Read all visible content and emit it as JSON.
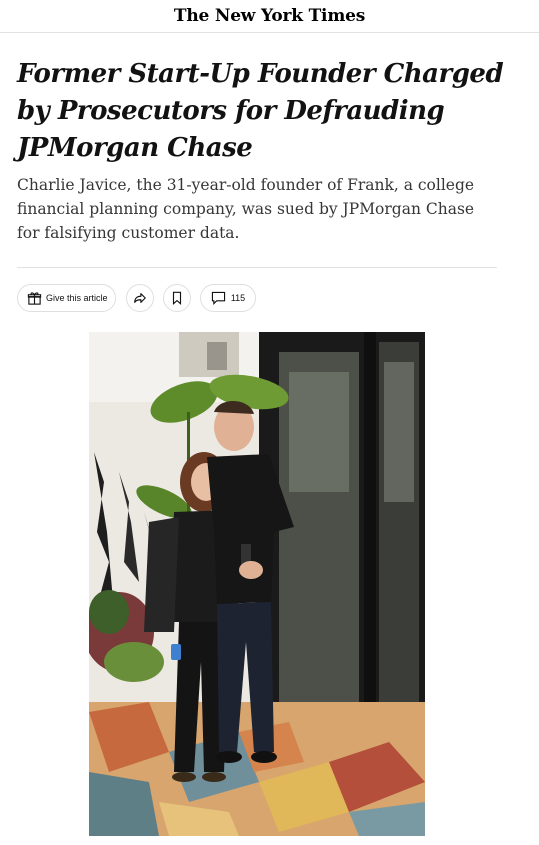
{
  "masthead": {
    "logo_text": "The New York Times"
  },
  "article": {
    "headline": "Former Start-Up Founder Charged by Prosecutors for Defrauding JPMorgan Chase",
    "summary": "Charlie Javice, the 31-year-old founder of Frank, a college financial planning company, was sued by JPMorgan Chase for falsifying customer data."
  },
  "toolbar": {
    "gift_label": "Give this article",
    "gift_icon": "gift-icon",
    "share_icon": "share-arrow-icon",
    "save_icon": "bookmark-icon",
    "comment_icon": "comment-bubble-icon",
    "comment_count": "115"
  },
  "photo": {
    "description_icon": "article-photo"
  }
}
